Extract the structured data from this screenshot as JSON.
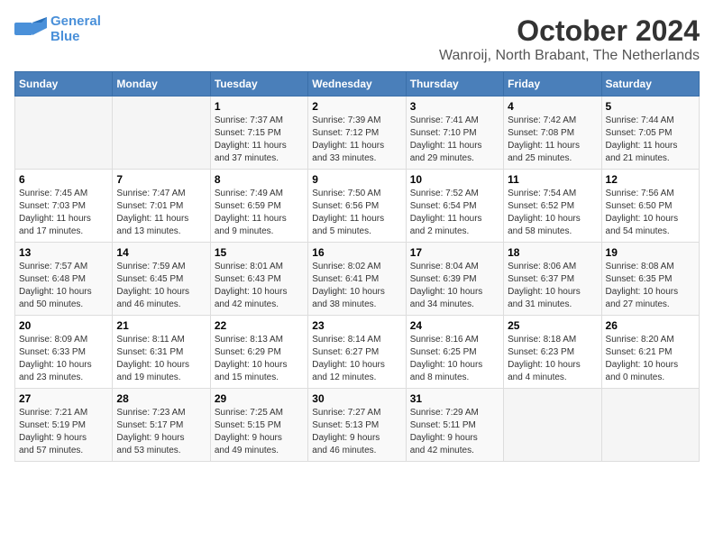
{
  "header": {
    "logo_line1": "General",
    "logo_line2": "Blue",
    "month_year": "October 2024",
    "location": "Wanroij, North Brabant, The Netherlands"
  },
  "columns": [
    "Sunday",
    "Monday",
    "Tuesday",
    "Wednesday",
    "Thursday",
    "Friday",
    "Saturday"
  ],
  "weeks": [
    [
      {
        "day": "",
        "info": ""
      },
      {
        "day": "",
        "info": ""
      },
      {
        "day": "1",
        "info": "Sunrise: 7:37 AM\nSunset: 7:15 PM\nDaylight: 11 hours\nand 37 minutes."
      },
      {
        "day": "2",
        "info": "Sunrise: 7:39 AM\nSunset: 7:12 PM\nDaylight: 11 hours\nand 33 minutes."
      },
      {
        "day": "3",
        "info": "Sunrise: 7:41 AM\nSunset: 7:10 PM\nDaylight: 11 hours\nand 29 minutes."
      },
      {
        "day": "4",
        "info": "Sunrise: 7:42 AM\nSunset: 7:08 PM\nDaylight: 11 hours\nand 25 minutes."
      },
      {
        "day": "5",
        "info": "Sunrise: 7:44 AM\nSunset: 7:05 PM\nDaylight: 11 hours\nand 21 minutes."
      }
    ],
    [
      {
        "day": "6",
        "info": "Sunrise: 7:45 AM\nSunset: 7:03 PM\nDaylight: 11 hours\nand 17 minutes."
      },
      {
        "day": "7",
        "info": "Sunrise: 7:47 AM\nSunset: 7:01 PM\nDaylight: 11 hours\nand 13 minutes."
      },
      {
        "day": "8",
        "info": "Sunrise: 7:49 AM\nSunset: 6:59 PM\nDaylight: 11 hours\nand 9 minutes."
      },
      {
        "day": "9",
        "info": "Sunrise: 7:50 AM\nSunset: 6:56 PM\nDaylight: 11 hours\nand 5 minutes."
      },
      {
        "day": "10",
        "info": "Sunrise: 7:52 AM\nSunset: 6:54 PM\nDaylight: 11 hours\nand 2 minutes."
      },
      {
        "day": "11",
        "info": "Sunrise: 7:54 AM\nSunset: 6:52 PM\nDaylight: 10 hours\nand 58 minutes."
      },
      {
        "day": "12",
        "info": "Sunrise: 7:56 AM\nSunset: 6:50 PM\nDaylight: 10 hours\nand 54 minutes."
      }
    ],
    [
      {
        "day": "13",
        "info": "Sunrise: 7:57 AM\nSunset: 6:48 PM\nDaylight: 10 hours\nand 50 minutes."
      },
      {
        "day": "14",
        "info": "Sunrise: 7:59 AM\nSunset: 6:45 PM\nDaylight: 10 hours\nand 46 minutes."
      },
      {
        "day": "15",
        "info": "Sunrise: 8:01 AM\nSunset: 6:43 PM\nDaylight: 10 hours\nand 42 minutes."
      },
      {
        "day": "16",
        "info": "Sunrise: 8:02 AM\nSunset: 6:41 PM\nDaylight: 10 hours\nand 38 minutes."
      },
      {
        "day": "17",
        "info": "Sunrise: 8:04 AM\nSunset: 6:39 PM\nDaylight: 10 hours\nand 34 minutes."
      },
      {
        "day": "18",
        "info": "Sunrise: 8:06 AM\nSunset: 6:37 PM\nDaylight: 10 hours\nand 31 minutes."
      },
      {
        "day": "19",
        "info": "Sunrise: 8:08 AM\nSunset: 6:35 PM\nDaylight: 10 hours\nand 27 minutes."
      }
    ],
    [
      {
        "day": "20",
        "info": "Sunrise: 8:09 AM\nSunset: 6:33 PM\nDaylight: 10 hours\nand 23 minutes."
      },
      {
        "day": "21",
        "info": "Sunrise: 8:11 AM\nSunset: 6:31 PM\nDaylight: 10 hours\nand 19 minutes."
      },
      {
        "day": "22",
        "info": "Sunrise: 8:13 AM\nSunset: 6:29 PM\nDaylight: 10 hours\nand 15 minutes."
      },
      {
        "day": "23",
        "info": "Sunrise: 8:14 AM\nSunset: 6:27 PM\nDaylight: 10 hours\nand 12 minutes."
      },
      {
        "day": "24",
        "info": "Sunrise: 8:16 AM\nSunset: 6:25 PM\nDaylight: 10 hours\nand 8 minutes."
      },
      {
        "day": "25",
        "info": "Sunrise: 8:18 AM\nSunset: 6:23 PM\nDaylight: 10 hours\nand 4 minutes."
      },
      {
        "day": "26",
        "info": "Sunrise: 8:20 AM\nSunset: 6:21 PM\nDaylight: 10 hours\nand 0 minutes."
      }
    ],
    [
      {
        "day": "27",
        "info": "Sunrise: 7:21 AM\nSunset: 5:19 PM\nDaylight: 9 hours\nand 57 minutes."
      },
      {
        "day": "28",
        "info": "Sunrise: 7:23 AM\nSunset: 5:17 PM\nDaylight: 9 hours\nand 53 minutes."
      },
      {
        "day": "29",
        "info": "Sunrise: 7:25 AM\nSunset: 5:15 PM\nDaylight: 9 hours\nand 49 minutes."
      },
      {
        "day": "30",
        "info": "Sunrise: 7:27 AM\nSunset: 5:13 PM\nDaylight: 9 hours\nand 46 minutes."
      },
      {
        "day": "31",
        "info": "Sunrise: 7:29 AM\nSunset: 5:11 PM\nDaylight: 9 hours\nand 42 minutes."
      },
      {
        "day": "",
        "info": ""
      },
      {
        "day": "",
        "info": ""
      }
    ]
  ]
}
